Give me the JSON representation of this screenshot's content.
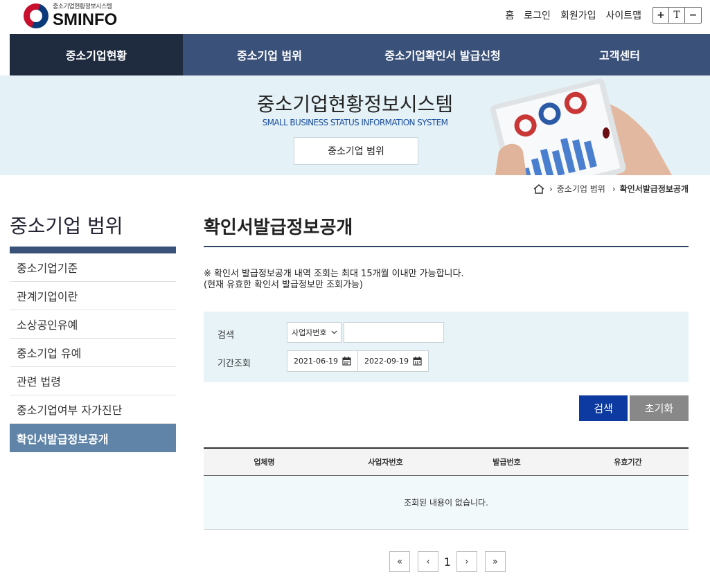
{
  "header": {
    "logo_sub": "중소기업현황정보시스템",
    "logo_main": "SMINFO",
    "util_links": [
      "홈",
      "로그인",
      "회원가입",
      "사이트맵"
    ],
    "font_controls": [
      "+",
      "T",
      "−"
    ]
  },
  "gnb": {
    "items": [
      "중소기업현황",
      "중소기업 범위",
      "중소기업확인서 발급신청",
      "고객센터"
    ],
    "active_index": 0
  },
  "banner": {
    "title": "중소기업현황정보시스템",
    "subtitle": "SMALL BUSINESS STATUS INFORMATION SYSTEM",
    "button": "중소기업 범위"
  },
  "breadcrumb": {
    "items": [
      "중소기업 범위",
      "확인서발급정보공개"
    ]
  },
  "lnb": {
    "title": "중소기업 범위",
    "items": [
      "중소기업기준",
      "관계기업이란",
      "소상공인유예",
      "중소기업 유예",
      "관련 법령",
      "중소기업여부 자가진단",
      "확인서발급정보공개"
    ],
    "active_index": 6
  },
  "content": {
    "title": "확인서발급정보공개",
    "notice_line1": "※ 확인서 발급정보공개 내역 조회는 최대 15개월 이내만 가능합니다.",
    "notice_line2": "(현재 유효한 확인서 발급정보만 조회가능)"
  },
  "search": {
    "label_search": "검색",
    "select_value": "사업자번호",
    "input_value": "",
    "label_period": "기간조회",
    "date_from": "2021-06-19",
    "date_to": "2022-09-19",
    "btn_search": "검색",
    "btn_reset": "초기화"
  },
  "table": {
    "columns": [
      "업체명",
      "사업자번호",
      "발급번호",
      "유효기간"
    ],
    "empty_message": "조회된 내용이 없습니다."
  },
  "pager": {
    "first": "«",
    "prev": "‹",
    "current": "1",
    "next": "›",
    "last": "»"
  },
  "colors": {
    "navy": "#3a5179",
    "navy_dark": "#1f2c3f",
    "lnb_active": "#5f84a8",
    "search_btn": "#0d3aa0"
  }
}
